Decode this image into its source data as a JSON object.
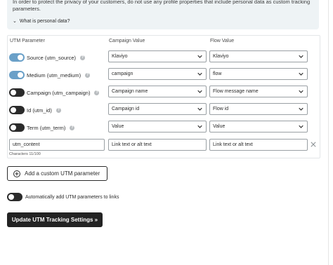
{
  "notice": {
    "text": "In order to protect the privacy of your customers, do not use any profile properties that include personal data as custom tracking parameters.",
    "disclosure_label": "What is personal data?"
  },
  "columns": {
    "param": "UTM Parameter",
    "campaign": "Campaign Value",
    "flow": "Flow Value"
  },
  "rows": [
    {
      "label": "Source (utm_source)",
      "enabled": true,
      "campaign_value": "Klaviyo",
      "flow_value": "Klaviyo"
    },
    {
      "label": "Medium (utm_medium)",
      "enabled": true,
      "campaign_value": "campaign",
      "flow_value": "flow"
    },
    {
      "label": "Campaign (utm_campaign)",
      "enabled": false,
      "campaign_value": "Campaign name",
      "flow_value": "Flow message name"
    },
    {
      "label": "Id (utm_id)",
      "enabled": false,
      "campaign_value": "Campaign id",
      "flow_value": "Flow id"
    },
    {
      "label": "Term (utm_term)",
      "enabled": false,
      "campaign_value": "Value",
      "flow_value": "Value"
    }
  ],
  "custom_row": {
    "param_value": "utm_content",
    "char_count": "Characters 11/100",
    "campaign_value": "Link text or alt text",
    "flow_value": "Link text or alt text"
  },
  "add_button_label": "Add a custom UTM parameter",
  "auto_add": {
    "label": "Automatically add UTM parameters to links",
    "enabled": false
  },
  "update_button_label": "Update UTM Tracking Settings »",
  "colors": {
    "toggle_on": "#6aa0c8",
    "toggle_off": "#2b2b2b",
    "primary_button": "#232323"
  }
}
